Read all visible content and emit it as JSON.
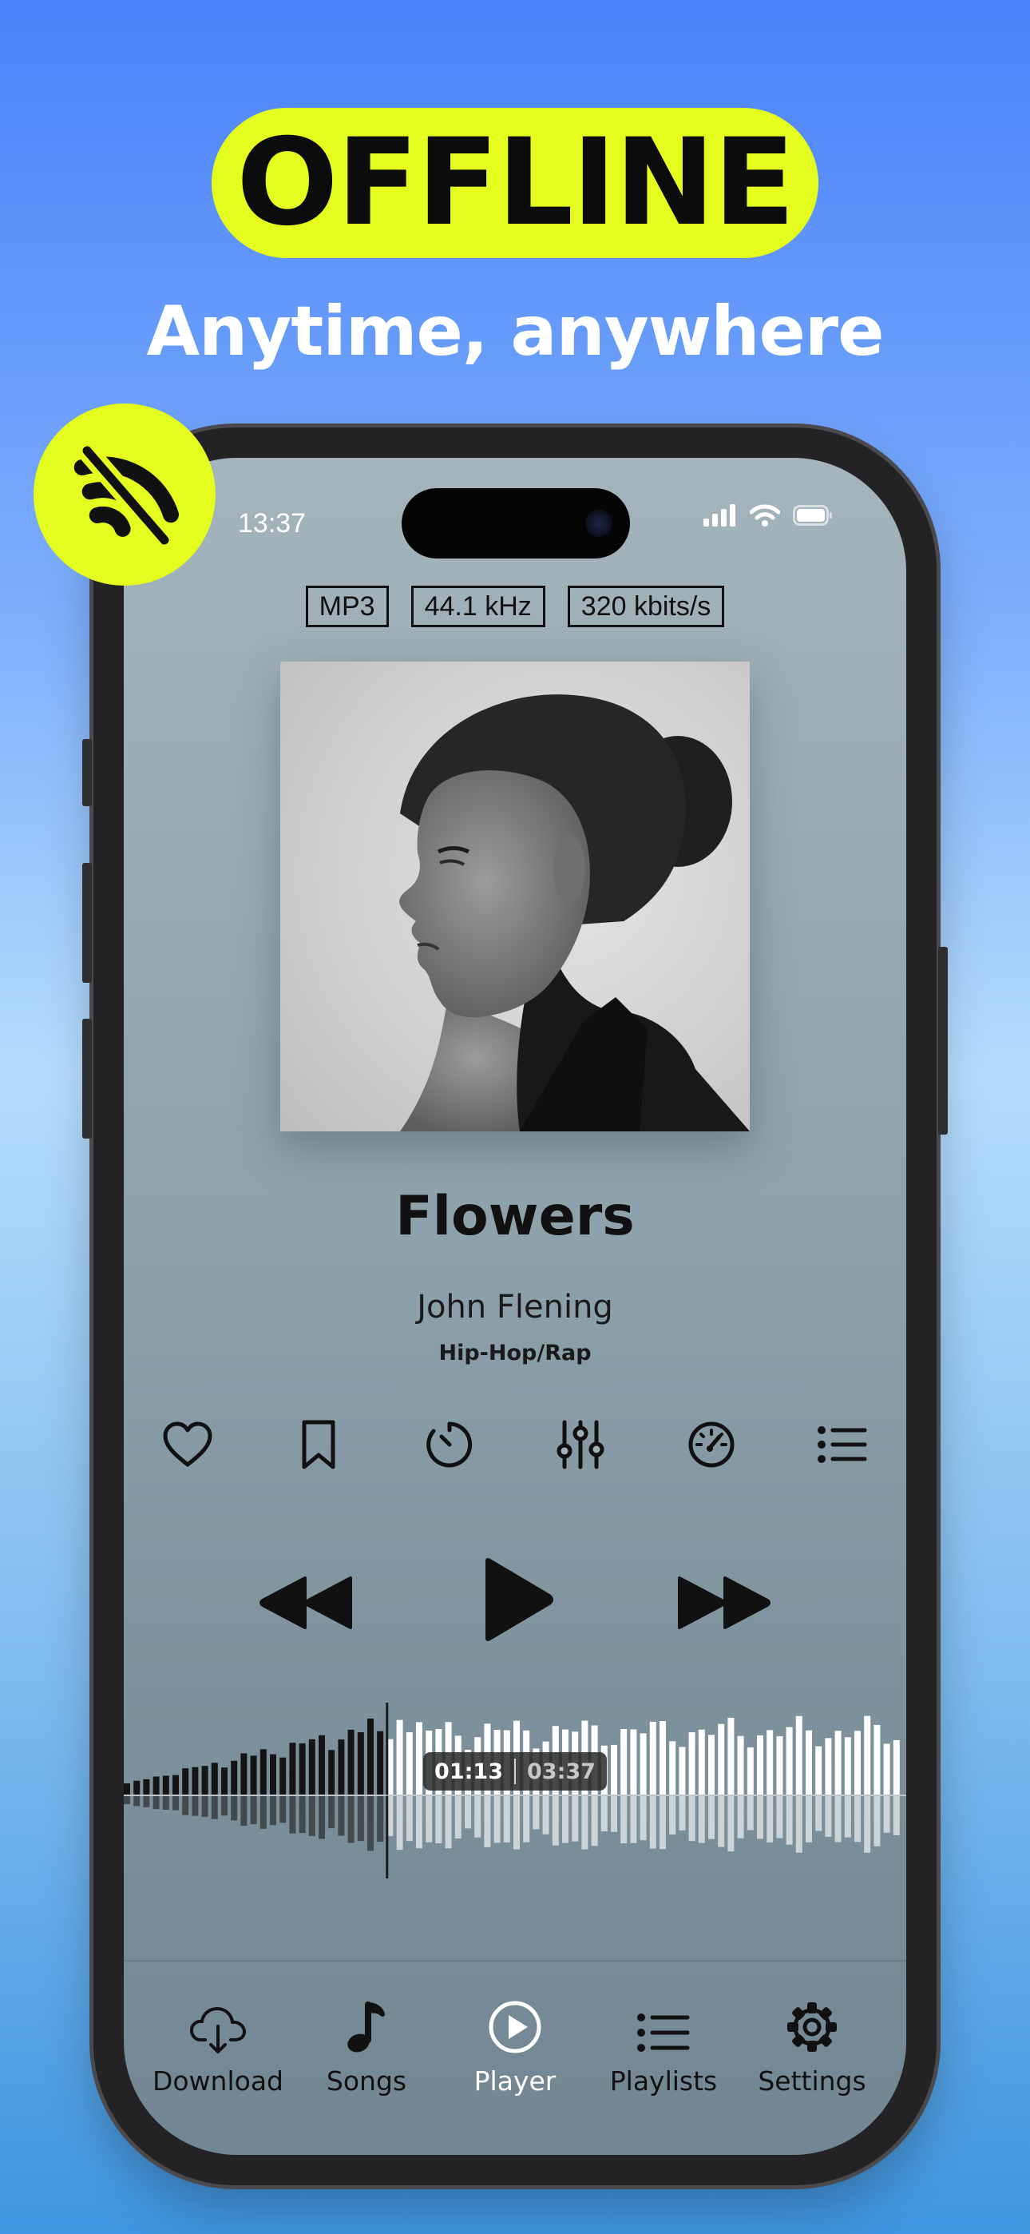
{
  "promo": {
    "headline": "OFFLINE",
    "subheadline": "Anytime, anywhere",
    "badge_icon": "wifi-off-icon",
    "accent_color": "#e4fc1e"
  },
  "status_bar": {
    "time": "13:37",
    "icons": [
      "signal-icon",
      "wifi-icon",
      "battery-icon"
    ]
  },
  "audio_info": {
    "tags": [
      "MP3",
      "44.1 kHz",
      "320 kbits/s"
    ]
  },
  "track": {
    "title": "Flowers",
    "artist": "John Flening",
    "genre": "Hip-Hop/Rap"
  },
  "actions": [
    "heart-icon",
    "bookmark-icon",
    "timer-icon",
    "equalizer-icon",
    "speed-icon",
    "queue-list-icon"
  ],
  "transport": [
    "rewind-icon",
    "play-icon",
    "fast-forward-icon"
  ],
  "progress": {
    "elapsed": "01:13",
    "total": "03:37",
    "fraction": 0.336
  },
  "tabbar": {
    "active": "Player",
    "tabs": [
      {
        "label": "Download",
        "icon": "cloud-download-icon"
      },
      {
        "label": "Songs",
        "icon": "music-note-icon"
      },
      {
        "label": "Player",
        "icon": "play-circle-icon"
      },
      {
        "label": "Playlists",
        "icon": "list-icon"
      },
      {
        "label": "Settings",
        "icon": "gear-icon"
      }
    ]
  }
}
